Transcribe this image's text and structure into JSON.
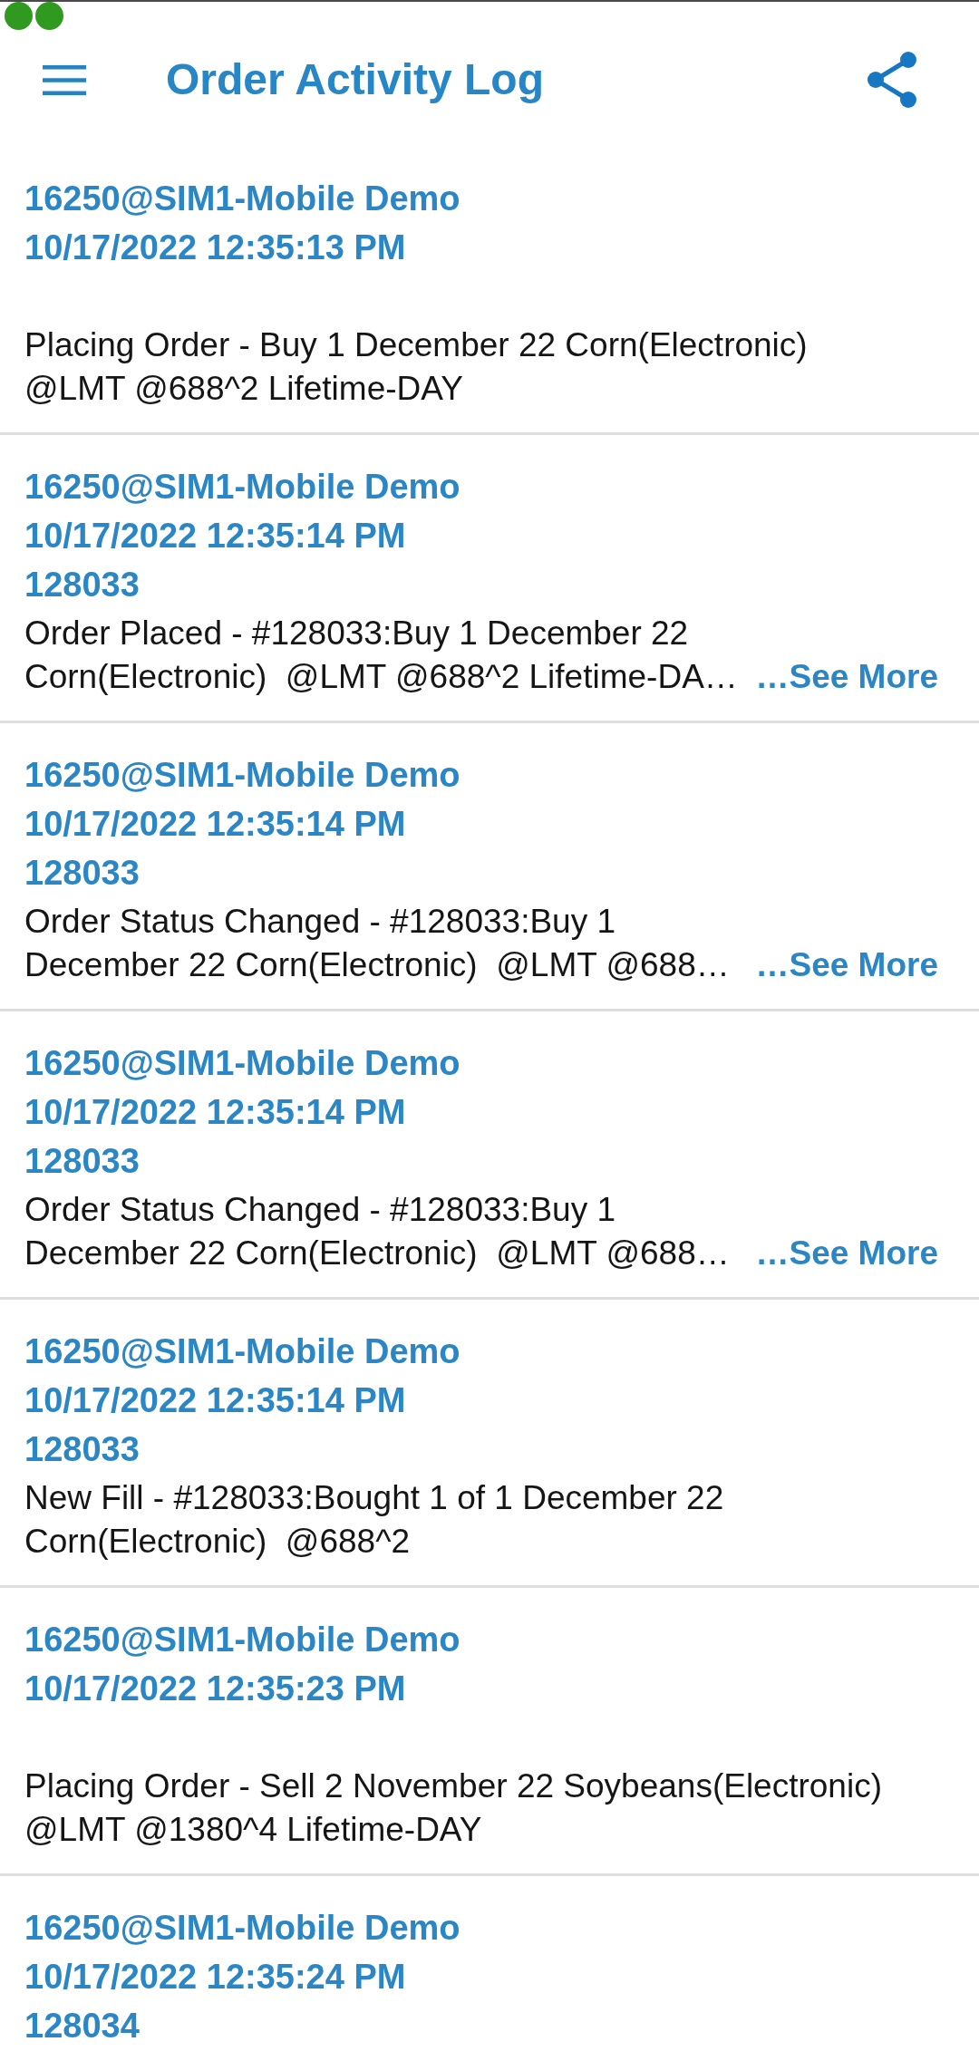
{
  "app_bar": {
    "title": "Order Activity Log"
  },
  "entries": [
    {
      "account": "16250@SIM1-Mobile Demo",
      "timestamp": "10/17/2022 12:35:13 PM",
      "description": "Placing Order - Buy 1 December 22 Corn(Electronic) @LMT @688^2 Lifetime-DAY"
    },
    {
      "account": "16250@SIM1-Mobile Demo",
      "timestamp": "10/17/2022 12:35:14 PM",
      "order_number": "128033",
      "description": "Order Placed - #128033:Buy 1 December 22 Corn(Electronic)  @LMT @688^2 Lifetime-DA…",
      "see_more": "…See More"
    },
    {
      "account": "16250@SIM1-Mobile Demo",
      "timestamp": "10/17/2022 12:35:14 PM",
      "order_number": "128033",
      "description": "Order Status Changed - #128033:Buy 1 December 22 Corn(Electronic)  @LMT @688…",
      "see_more": "…See More"
    },
    {
      "account": "16250@SIM1-Mobile Demo",
      "timestamp": "10/17/2022 12:35:14 PM",
      "order_number": "128033",
      "description": "Order Status Changed - #128033:Buy 1 December 22 Corn(Electronic)  @LMT @688…",
      "see_more": "…See More"
    },
    {
      "account": "16250@SIM1-Mobile Demo",
      "timestamp": "10/17/2022 12:35:14 PM",
      "order_number": "128033",
      "description": "New Fill - #128033:Bought 1 of 1 December 22 Corn(Electronic)  @688^2"
    },
    {
      "account": "16250@SIM1-Mobile Demo",
      "timestamp": "10/17/2022 12:35:23 PM",
      "description": "Placing Order - Sell 2 November 22 Soybeans(Electronic) @LMT @1380^4 Lifetime-DAY"
    },
    {
      "account": "16250@SIM1-Mobile Demo",
      "timestamp": "10/17/2022 12:35:24 PM",
      "order_number": "128034"
    }
  ]
}
